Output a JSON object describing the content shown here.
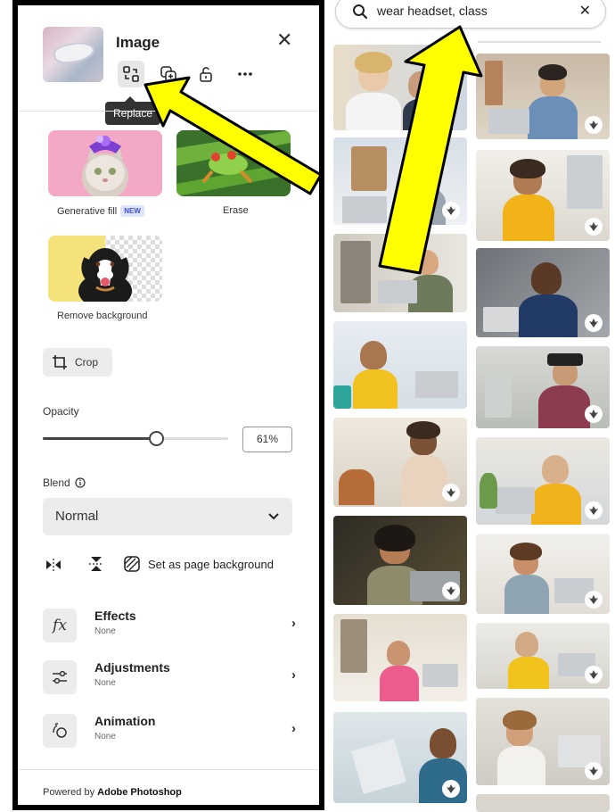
{
  "panel": {
    "title": "Image",
    "close_icon": "close-icon",
    "tools": [
      "replace-icon",
      "duplicate-icon",
      "unlock-icon",
      "more-icon"
    ],
    "tooltip": "Replace",
    "features": [
      {
        "label": "Generative fill",
        "badge": "NEW"
      },
      {
        "label": "Erase"
      },
      {
        "label": "Remove background"
      }
    ],
    "crop_label": "Crop",
    "opacity": {
      "label": "Opacity",
      "value": 0.61,
      "display": "61%"
    },
    "blend": {
      "label": "Blend",
      "selected": "Normal"
    },
    "page_background_label": "Set as page background",
    "rows": [
      {
        "title": "Effects",
        "sub": "None",
        "icon": "fx-icon"
      },
      {
        "title": "Adjustments",
        "sub": "None",
        "icon": "sliders-icon"
      },
      {
        "title": "Animation",
        "sub": "None",
        "icon": "animation-icon"
      }
    ],
    "footer_prefix": "Powered by",
    "footer_brand": "Adobe Photoshop"
  },
  "search": {
    "query": "wear headset, class",
    "search_icon": "search-icon",
    "clear_icon": "close-icon"
  },
  "colors": {
    "arrow_fill": "#ffff00",
    "arrow_stroke": "#000000",
    "accent_badge": "#3b52d3",
    "panel_border": "#000000"
  }
}
